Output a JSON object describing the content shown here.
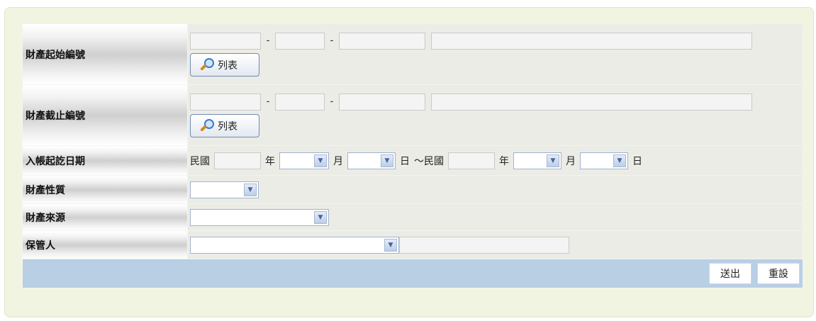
{
  "rows": {
    "start_no": {
      "label": "財產起始編號",
      "list_button": "列表",
      "dash1": "-",
      "dash2": "-"
    },
    "end_no": {
      "label": "財產截止編號",
      "list_button": "列表",
      "dash1": "-",
      "dash2": "-"
    },
    "entry_date": {
      "label": "入帳起訖日期",
      "era1": "民國",
      "year1": "年",
      "month1": "月",
      "day1": "日",
      "range_prefix": "～民國",
      "year2": "年",
      "month2": "月",
      "day2": "日"
    },
    "nature": {
      "label": "財產性質",
      "selected": ""
    },
    "source": {
      "label": "財產來源",
      "selected": ""
    },
    "keeper": {
      "label": "保管人",
      "selected": "",
      "text_value": ""
    }
  },
  "actions": {
    "submit": "送出",
    "reset": "重設"
  },
  "colors": {
    "panel_bg": "#f1f4e1",
    "value_bg": "#ecece6",
    "footer_bg": "#b8cfe4"
  },
  "icons": {
    "list": "magnifier-icon",
    "dropdown": "chevron-down-icon"
  }
}
